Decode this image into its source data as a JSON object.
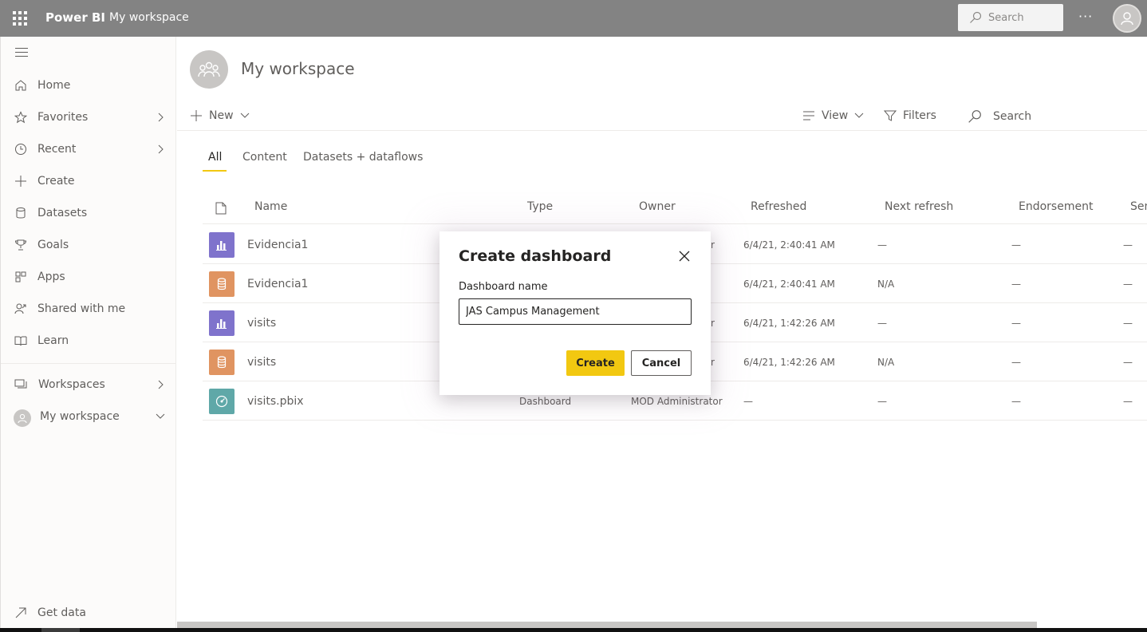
{
  "topbar": {
    "brand": "Power BI",
    "breadcrumb": "My workspace",
    "search_placeholder": "Search",
    "more": "···"
  },
  "sidebar": {
    "items": [
      {
        "label": "Home",
        "icon": "home-icon"
      },
      {
        "label": "Favorites",
        "icon": "star-icon",
        "chevron": true
      },
      {
        "label": "Recent",
        "icon": "clock-icon",
        "chevron": true
      },
      {
        "label": "Create",
        "icon": "plus-icon"
      },
      {
        "label": "Datasets",
        "icon": "cylinder-icon"
      },
      {
        "label": "Goals",
        "icon": "trophy-icon"
      },
      {
        "label": "Apps",
        "icon": "apps-icon"
      },
      {
        "label": "Shared with me",
        "icon": "shared-icon"
      },
      {
        "label": "Learn",
        "icon": "book-icon"
      }
    ],
    "workspaces_label": "Workspaces",
    "my_workspace_label": "My workspace",
    "get_data_label": "Get data"
  },
  "main": {
    "title": "My workspace",
    "commands": {
      "new": "New",
      "view": "View",
      "filters": "Filters",
      "search": "Search"
    },
    "tabs": [
      "All",
      "Content",
      "Datasets + dataflows"
    ],
    "columns": [
      "Name",
      "Type",
      "Owner",
      "Refreshed",
      "Next refresh",
      "Endorsement",
      "Sen"
    ],
    "rows": [
      {
        "name": "Evidencia1",
        "kind": "report",
        "type": "",
        "owner": "r",
        "refreshed": "6/4/21, 2:40:41 AM",
        "next": "—",
        "endorse": "—",
        "sens": "—"
      },
      {
        "name": "Evidencia1",
        "kind": "dataset",
        "type": "",
        "owner": "",
        "refreshed": "6/4/21, 2:40:41 AM",
        "next": "N/A",
        "endorse": "—",
        "sens": "—"
      },
      {
        "name": "visits",
        "kind": "report",
        "type": "",
        "owner": "r",
        "refreshed": "6/4/21, 1:42:26 AM",
        "next": "—",
        "endorse": "—",
        "sens": "—"
      },
      {
        "name": "visits",
        "kind": "dataset",
        "type": "",
        "owner": "r",
        "refreshed": "6/4/21, 1:42:26 AM",
        "next": "N/A",
        "endorse": "—",
        "sens": "—"
      },
      {
        "name": "visits.pbix",
        "kind": "dashboard",
        "type": "Dashboard",
        "owner": "MOD Administrator",
        "refreshed": "—",
        "next": "—",
        "endorse": "—",
        "sens": "—"
      }
    ]
  },
  "modal": {
    "title": "Create dashboard",
    "field_label": "Dashboard name",
    "field_value": "JAS Campus Management",
    "create_label": "Create",
    "cancel_label": "Cancel"
  },
  "colors": {
    "topbar": "#838383",
    "accent": "#f2c811",
    "report_icon": "#7f73cc",
    "dataset_icon": "#e09461",
    "dashboard_icon": "#5fa8a8"
  }
}
